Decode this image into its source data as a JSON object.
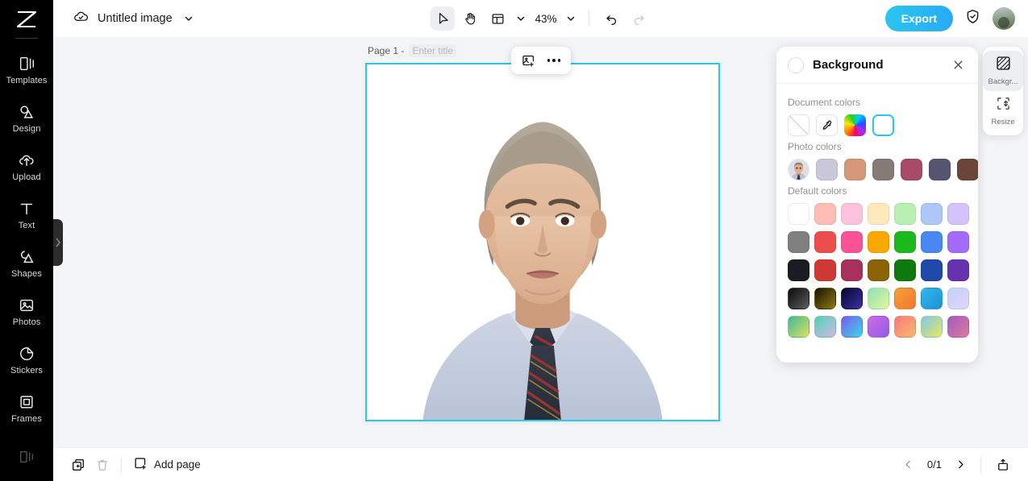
{
  "app": {
    "name": "image-editor"
  },
  "topbar": {
    "cloud_icon": "cloud-check-icon",
    "doc_title": "Untitled image",
    "title_chevron": "chevron-down-icon",
    "tools": [
      {
        "name": "select-tool",
        "icon": "cursor-arrow-icon",
        "active": true
      },
      {
        "name": "hand-tool",
        "icon": "hand-icon",
        "active": false
      },
      {
        "name": "layout-tool",
        "icon": "layout-grid-icon",
        "active": false
      }
    ],
    "layout_chevron": "chevron-down-icon",
    "zoom_level": "43%",
    "zoom_chevron": "chevron-down-icon",
    "undo_icon": "undo-arrow-icon",
    "redo_icon": "redo-arrow-icon",
    "export_label": "Export",
    "shield_icon": "shield-check-icon",
    "avatar_icon": "user-avatar"
  },
  "sidebar": {
    "logo_icon": "app-logo-icon",
    "collapse_icon": "chevron-right-icon",
    "items": [
      {
        "label": "Templates",
        "icon": "templates-icon"
      },
      {
        "label": "Design",
        "icon": "design-icon"
      },
      {
        "label": "Upload",
        "icon": "upload-cloud-icon"
      },
      {
        "label": "Text",
        "icon": "text-t-icon"
      },
      {
        "label": "Shapes",
        "icon": "shapes-icon"
      },
      {
        "label": "Photos",
        "icon": "photo-icon"
      },
      {
        "label": "Stickers",
        "icon": "sticker-icon"
      },
      {
        "label": "Frames",
        "icon": "frame-icon"
      }
    ]
  },
  "canvas": {
    "page_label": "Page 1 -",
    "title_placeholder": "Enter title",
    "selection_color": "#29c8e6",
    "background_color": "#ffffff",
    "floating_toolbar": {
      "replace_image_icon": "image-plus-icon",
      "more_icon": "ellipsis-icon"
    },
    "image": {
      "name": "portrait-photo",
      "description": "man in light blue shirt with dark striped tie"
    }
  },
  "panel": {
    "title": "Background",
    "swatch_icon": "current-color-circle",
    "close_icon": "close-x-icon",
    "sections": [
      {
        "label": "Document colors",
        "swatches": [
          {
            "name": "transparent-swatch",
            "kind": "transparent",
            "color": "#ffffff"
          },
          {
            "name": "eyedropper-swatch",
            "kind": "picker",
            "color": "#ffffff"
          },
          {
            "name": "color-wheel-swatch",
            "kind": "rainbow",
            "color": "#ff0059"
          },
          {
            "name": "white-swatch",
            "kind": "solid",
            "color": "#ffffff",
            "selected": true
          }
        ]
      },
      {
        "label": "Photo colors",
        "swatches": [
          {
            "name": "photo-thumbnail-swatch",
            "kind": "photo",
            "color": "#b9a894"
          },
          {
            "name": "photo-color-1",
            "kind": "solid",
            "color": "#c9c8da"
          },
          {
            "name": "photo-color-2",
            "kind": "solid",
            "color": "#d49878"
          },
          {
            "name": "photo-color-3",
            "kind": "solid",
            "color": "#857a76"
          },
          {
            "name": "photo-color-4",
            "kind": "solid",
            "color": "#a94a68"
          },
          {
            "name": "photo-color-5",
            "kind": "solid",
            "color": "#555572"
          },
          {
            "name": "photo-color-6",
            "kind": "solid",
            "color": "#6b4539"
          }
        ]
      },
      {
        "label": "Default colors",
        "grid": [
          [
            "#ffffff",
            "#ffbdb5",
            "#ffc2dd",
            "#ffe9bb",
            "#b8f0b2",
            "#afc6f9",
            "#d4c2fb"
          ],
          [
            "#808080",
            "#ec4e4b",
            "#fc5296",
            "#f9a800",
            "#1cb91c",
            "#4a87f2",
            "#a36bf7"
          ],
          [
            "#1b1b23",
            "#cc3a33",
            "#a92f5c",
            "#8a6208",
            "#0c7a0c",
            "#1f49a8",
            "#6632b0"
          ],
          [
            "linear-gradient(135deg,#0a0a0a,#5e5e5e)",
            "linear-gradient(135deg,#161204,#8f7a10)",
            "linear-gradient(135deg,#07062a,#3b2fa8)",
            "linear-gradient(135deg,#8ae2b8,#e7f59a)",
            "linear-gradient(135deg,#f6a03a,#f2762f)",
            "linear-gradient(135deg,#2fb7e8,#2090d8)",
            "linear-gradient(135deg,#c4d2f7,#e0d4fa)"
          ],
          [
            "linear-gradient(135deg,#3cb99b,#e0e05c)",
            "linear-gradient(135deg,#4ad6b0,#d9b3e8)",
            "linear-gradient(135deg,#7a5cf0,#3ad6e8)",
            "linear-gradient(135deg,#d46be0,#8a5ce8)",
            "linear-gradient(135deg,#f97a7a,#f9b86a)",
            "linear-gradient(135deg,#7ec8f0,#e8e85c)",
            "linear-gradient(135deg,#a05cc4,#e07a9a)"
          ]
        ]
      }
    ]
  },
  "panel_tabs": [
    {
      "label": "Backgr...",
      "icon": "background-pattern-icon",
      "active": true,
      "name": "tab-background"
    },
    {
      "label": "Resize",
      "icon": "resize-icon",
      "active": false,
      "name": "tab-resize"
    }
  ],
  "bottombar": {
    "duplicate_icon": "duplicate-page-icon",
    "delete_icon": "trash-icon",
    "add_page_icon": "add-page-icon",
    "add_page_label": "Add page",
    "prev_icon": "chevron-left-icon",
    "page_count": "0/1",
    "next_icon": "chevron-right-icon",
    "present_icon": "present-upload-icon"
  }
}
